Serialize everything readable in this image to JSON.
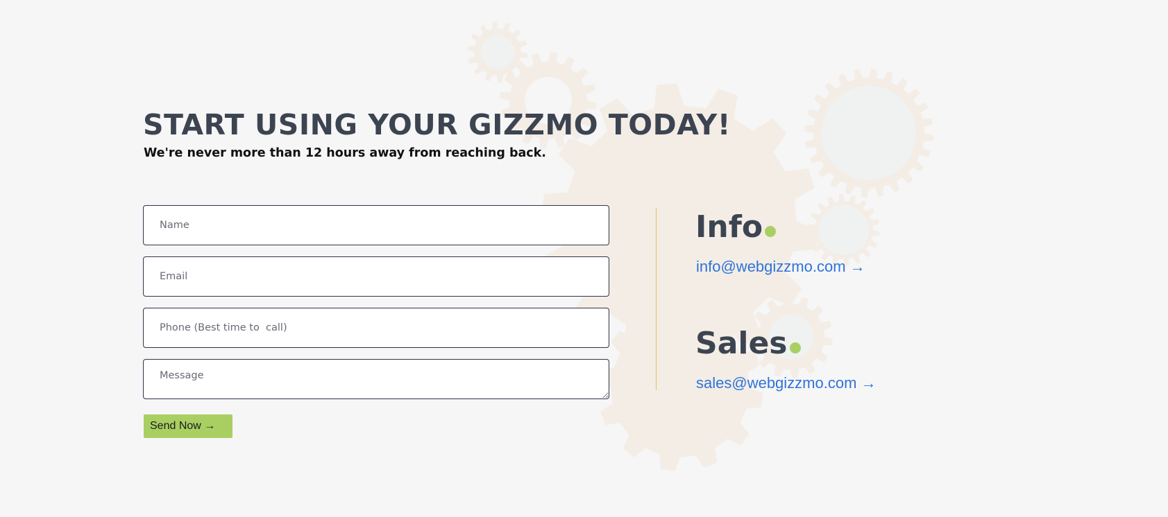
{
  "heading": {
    "title": "START USING YOUR GIZZMO TODAY!",
    "subtitle": "We're never more than 12 hours away from reaching back."
  },
  "form": {
    "name_placeholder": "Name",
    "email_placeholder": "Email",
    "phone_placeholder": "Phone (Best time to  call)",
    "message_placeholder": "Message",
    "send_label": "Send Now →"
  },
  "contacts": {
    "info": {
      "title": "Info",
      "link": "info@webgizzmo.com →"
    },
    "sales": {
      "title": "Sales",
      "link": "sales@webgizzmo.com →"
    }
  },
  "colors": {
    "accent_green": "#a9cf63",
    "link_blue": "#2f73d8",
    "heading_gray": "#3d4451",
    "divider_gold": "#e0c25c"
  }
}
